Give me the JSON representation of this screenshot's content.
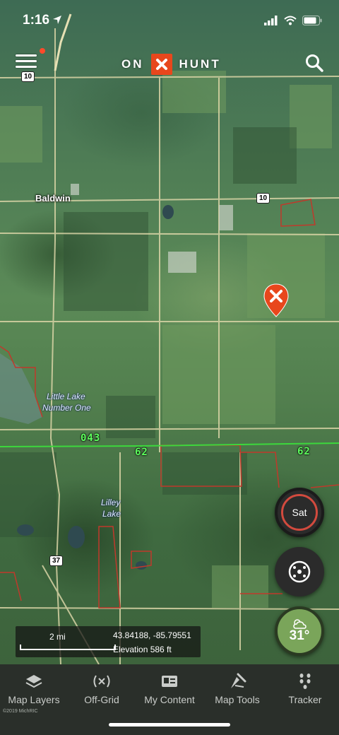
{
  "status_bar": {
    "time": "1:16"
  },
  "header": {
    "logo_left": "ON",
    "logo_right": "HUNT"
  },
  "map": {
    "town": "Baldwin",
    "lake_1_line1": "Little Lake",
    "lake_1_line2": "Number One",
    "lake_2_line1": "Lilley",
    "lake_2_line1b": "Lake",
    "unit_043": "043",
    "unit_62a": "62",
    "unit_62b": "62",
    "shield_10a": "10",
    "shield_10b": "10",
    "shield_37": "37"
  },
  "controls": {
    "layer_toggle": "Sat",
    "weather_temp": "31°"
  },
  "info": {
    "scale": "2 mi",
    "coordinates": "43.84188, -85.79551",
    "elevation": "Elevation 586 ft"
  },
  "nav": {
    "items": [
      {
        "label": "Map Layers",
        "icon": "map-layers-icon"
      },
      {
        "label": "Off-Grid",
        "icon": "off-grid-icon"
      },
      {
        "label": "My Content",
        "icon": "my-content-icon"
      },
      {
        "label": "Map Tools",
        "icon": "map-tools-icon"
      },
      {
        "label": "Tracker",
        "icon": "tracker-icon"
      }
    ]
  },
  "copyright": "©2019 MichRIC",
  "colors": {
    "accent": "#e8471c",
    "unit_line": "#3cd83c",
    "parcel": "#c0392b",
    "nav_bg": "#2a2f2a"
  }
}
